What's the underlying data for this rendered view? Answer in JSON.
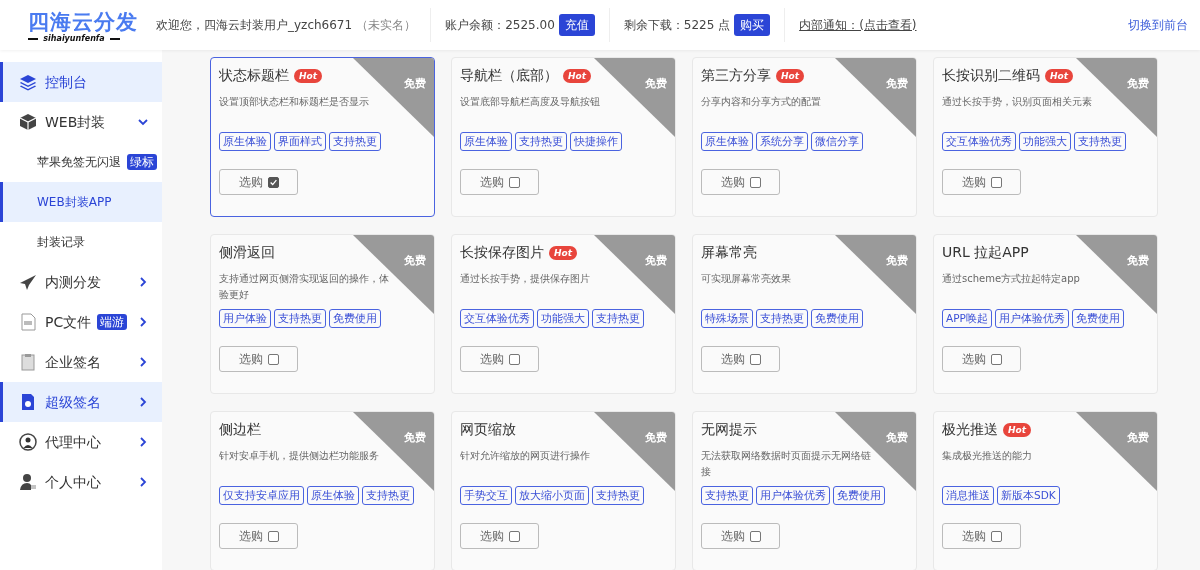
{
  "header": {
    "logo": "四海云分发",
    "logo_sub": "sihaiyunfenfa",
    "welcome": "欢迎您，四海云封装用户_yzch6671",
    "verify_status": "（未实名）",
    "balance_label": "账户余额：2525.00",
    "recharge_button": "充值",
    "downloads_label": "剩余下载：5225 点",
    "buy_button": "购买",
    "notice": "内部通知：(点击查看)",
    "switch_link": "切换到前台"
  },
  "sidebar": {
    "items": [
      {
        "label": "控制台",
        "selected": true
      },
      {
        "label": "WEB封装",
        "selected": false,
        "expanded": true,
        "children": [
          {
            "label": "苹果免签无闪退",
            "selected": false,
            "badge": "绿标"
          },
          {
            "label": "WEB封装APP",
            "selected": true
          },
          {
            "label": "封装记录",
            "selected": false
          }
        ]
      },
      {
        "label": "内测分发",
        "selected": false,
        "expanded": false
      },
      {
        "label": "PC文件",
        "selected": false,
        "expanded": false,
        "badge": "端游"
      },
      {
        "label": "企业签名",
        "selected": false,
        "expanded": false
      },
      {
        "label": "超级签名",
        "selected": true,
        "expanded": false
      },
      {
        "label": "代理中心",
        "selected": false,
        "expanded": false
      },
      {
        "label": "个人中心",
        "selected": false,
        "expanded": false
      }
    ]
  },
  "cards": [
    {
      "title": "状态标题栏",
      "hot": "Hot",
      "price": "免费",
      "description": "设置顶部状态栏和标题栏是否显示",
      "tags": [
        "原生体验",
        "界面样式",
        "支持热更"
      ],
      "button": "选购",
      "checked": true,
      "selected": true
    },
    {
      "title": "导航栏（底部）",
      "hot": "Hot",
      "price": "免费",
      "description": "设置底部导航栏高度及导航按钮",
      "tags": [
        "原生体验",
        "支持热更",
        "快捷操作"
      ],
      "button": "选购",
      "checked": false,
      "selected": false
    },
    {
      "title": "第三方分享",
      "hot": "Hot",
      "price": "免费",
      "description": "分享内容和分享方式的配置",
      "tags": [
        "原生体验",
        "系统分享",
        "微信分享"
      ],
      "button": "选购",
      "checked": false,
      "selected": false
    },
    {
      "title": "长按识别二维码",
      "hot": "Hot",
      "price": "免费",
      "description": "通过长按手势，识别页面相关元素",
      "tags": [
        "交互体验优秀",
        "功能强大",
        "支持热更"
      ],
      "button": "选购",
      "checked": false,
      "selected": false
    },
    {
      "title": "侧滑返回",
      "price": "免费",
      "description": "支持通过网页侧滑实现返回的操作，体验更好",
      "tags": [
        "用户体验",
        "支持热更",
        "免费使用"
      ],
      "button": "选购",
      "checked": false,
      "selected": false
    },
    {
      "title": "长按保存图片",
      "hot": "Hot",
      "price": "免费",
      "description": "通过长按手势，提供保存图片",
      "tags": [
        "交互体验优秀",
        "功能强大",
        "支持热更"
      ],
      "button": "选购",
      "checked": false,
      "selected": false
    },
    {
      "title": "屏幕常亮",
      "price": "免费",
      "description": "可实现屏幕常亮效果",
      "tags": [
        "特殊场景",
        "支持热更",
        "免费使用"
      ],
      "button": "选购",
      "checked": false,
      "selected": false
    },
    {
      "title": "URL 拉起APP",
      "price": "免费",
      "description": "通过scheme方式拉起特定app",
      "tags": [
        "APP唤起",
        "用户体验优秀",
        "免费使用"
      ],
      "button": "选购",
      "checked": false,
      "selected": false
    },
    {
      "title": "侧边栏",
      "price": "免费",
      "description": "针对安卓手机，提供侧边栏功能服务",
      "tags": [
        "仅支持安卓应用",
        "原生体验",
        "支持热更"
      ],
      "button": "选购",
      "checked": false,
      "selected": false
    },
    {
      "title": "网页缩放",
      "price": "免费",
      "description": "针对允许缩放的网页进行操作",
      "tags": [
        "手势交互",
        "放大缩小页面",
        "支持热更"
      ],
      "button": "选购",
      "checked": false,
      "selected": false
    },
    {
      "title": "无网提示",
      "price": "免费",
      "description": "无法获取网络数据时页面提示无网络链接",
      "tags": [
        "支持热更",
        "用户体验优秀",
        "免费使用"
      ],
      "button": "选购",
      "checked": false,
      "selected": false
    },
    {
      "title": "极光推送",
      "hot": "Hot",
      "price": "免费",
      "description": "集成极光推送的能力",
      "tags": [
        "消息推送",
        "新版本SDK"
      ],
      "button": "选购",
      "checked": false,
      "selected": false
    }
  ]
}
